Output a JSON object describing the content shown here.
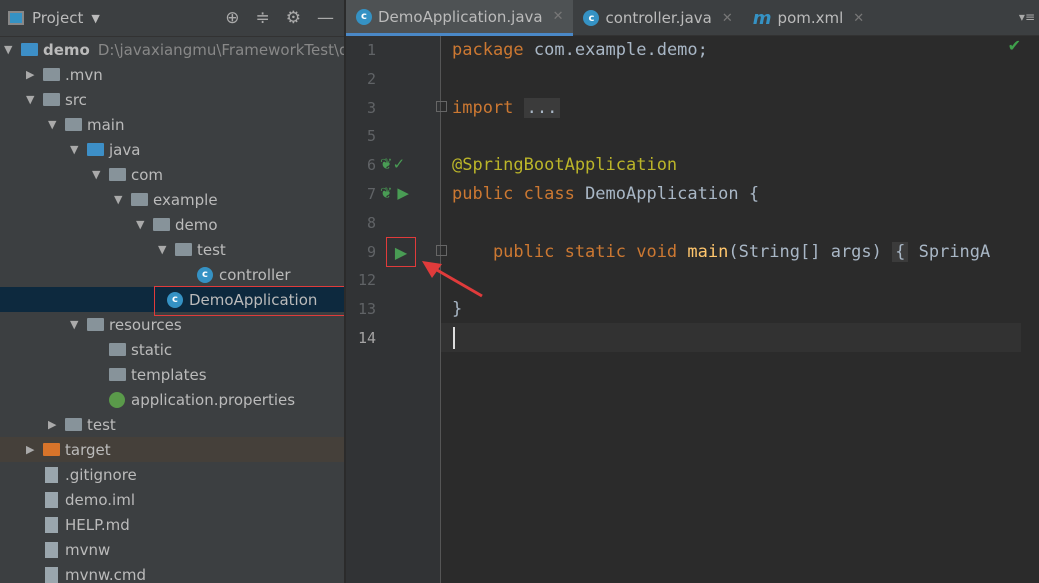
{
  "sidebar": {
    "title": "Project",
    "tree": [
      {
        "label": "demo",
        "path": "D:\\javaxiangmu\\FrameworkTest\\de",
        "level": 0,
        "expanded": true,
        "icon": "module-folder-icon"
      },
      {
        "label": ".mvn",
        "level": 1,
        "expanded": false,
        "icon": "folder-icon"
      },
      {
        "label": "src",
        "level": 1,
        "expanded": true,
        "icon": "folder-icon"
      },
      {
        "label": "main",
        "level": 2,
        "expanded": true,
        "icon": "folder-icon"
      },
      {
        "label": "java",
        "level": 3,
        "expanded": true,
        "icon": "source-folder-icon"
      },
      {
        "label": "com",
        "level": 4,
        "expanded": true,
        "icon": "package-icon"
      },
      {
        "label": "example",
        "level": 5,
        "expanded": true,
        "icon": "package-icon"
      },
      {
        "label": "demo",
        "level": 6,
        "expanded": true,
        "icon": "package-icon"
      },
      {
        "label": "test",
        "level": 7,
        "expanded": true,
        "icon": "package-icon"
      },
      {
        "label": "controller",
        "level": 8,
        "icon": "class-icon"
      },
      {
        "label": "DemoApplication",
        "level": 7.1,
        "icon": "spring-boot-class-icon",
        "selected": true
      },
      {
        "label": "resources",
        "level": 3,
        "expanded": true,
        "icon": "resources-folder-icon"
      },
      {
        "label": "static",
        "level": 4,
        "icon": "folder-icon"
      },
      {
        "label": "templates",
        "level": 4,
        "icon": "folder-icon"
      },
      {
        "label": "application.properties",
        "level": 4,
        "icon": "spring-properties-icon"
      },
      {
        "label": "test",
        "level": 2,
        "expanded": false,
        "icon": "folder-icon"
      },
      {
        "label": "target",
        "level": 1,
        "expanded": false,
        "icon": "excluded-folder-icon"
      },
      {
        "label": ".gitignore",
        "level": 1,
        "icon": "file-icon"
      },
      {
        "label": "demo.iml",
        "level": 1,
        "icon": "file-icon"
      },
      {
        "label": "HELP.md",
        "level": 1,
        "icon": "markdown-icon"
      },
      {
        "label": "mvnw",
        "level": 1,
        "icon": "shell-icon"
      },
      {
        "label": "mvnw.cmd",
        "level": 1,
        "icon": "cmd-icon"
      }
    ]
  },
  "tabs": [
    {
      "label": "DemoApplication.java",
      "active": true
    },
    {
      "label": "controller.java"
    },
    {
      "label": "pom.xml"
    }
  ],
  "editor": {
    "lines": [
      {
        "n": "1",
        "parts": [
          [
            "kw",
            "package "
          ],
          [
            "",
            "com.example.demo;"
          ]
        ]
      },
      {
        "n": "2",
        "parts": []
      },
      {
        "n": "3",
        "parts": [
          [
            "kw",
            "import "
          ],
          [
            "fold",
            "..."
          ]
        ]
      },
      {
        "n": "5",
        "parts": []
      },
      {
        "n": "6",
        "parts": [
          [
            "an",
            "@SpringBootApplication"
          ]
        ]
      },
      {
        "n": "7",
        "parts": [
          [
            "kw",
            "public class "
          ],
          [
            "",
            "DemoApplication {"
          ]
        ]
      },
      {
        "n": "8",
        "parts": []
      },
      {
        "n": "9",
        "parts": [
          [
            "kw",
            "    public static void "
          ],
          [
            "fn",
            "main"
          ],
          [
            "",
            "(String[] args) "
          ],
          [
            "fold",
            "{"
          ],
          [
            "",
            " SpringA"
          ]
        ]
      },
      {
        "n": "12",
        "parts": []
      },
      {
        "n": "13",
        "parts": [
          [
            "",
            "}"
          ]
        ]
      },
      {
        "n": "14",
        "parts": []
      }
    ]
  }
}
